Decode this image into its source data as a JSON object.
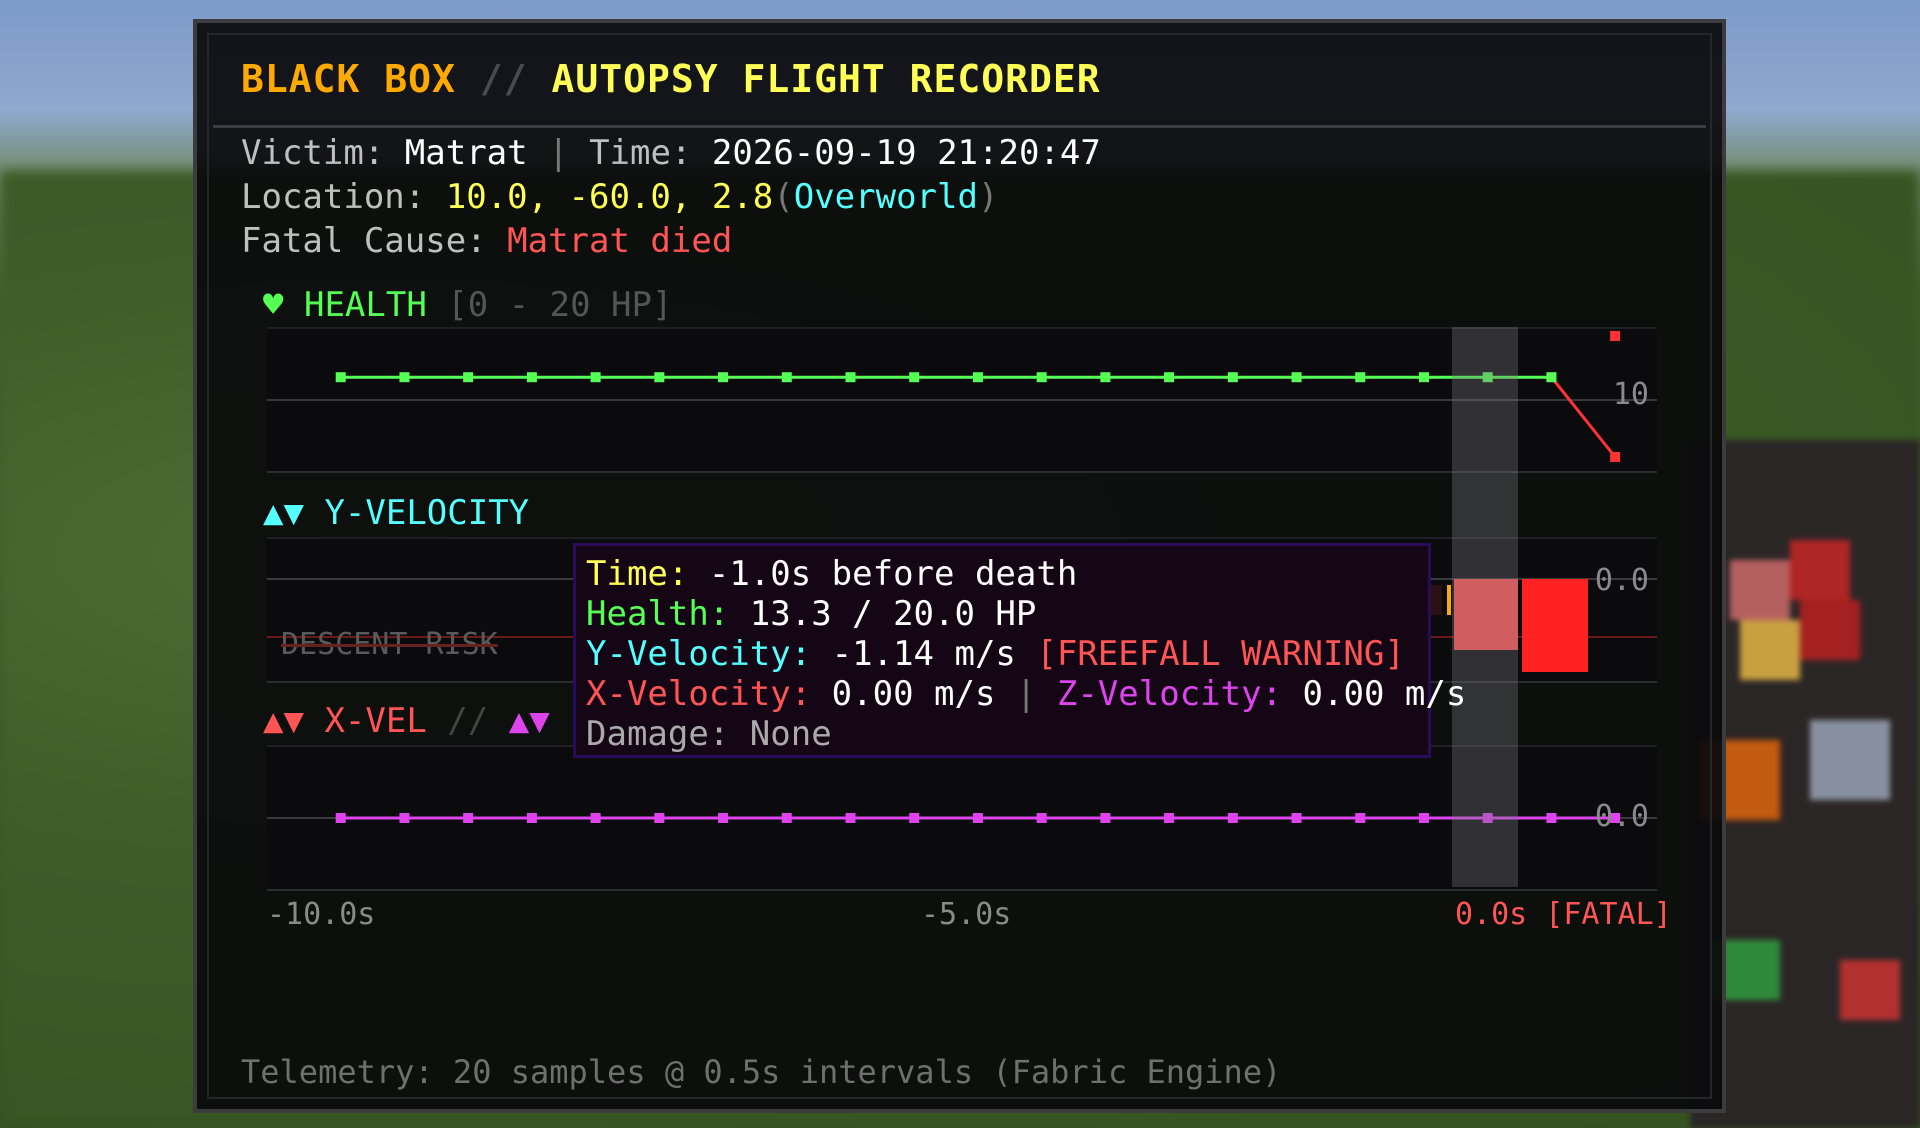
{
  "title": {
    "brand": "BLACK BOX",
    "sep": "//",
    "subtitle": "AUTOPSY FLIGHT RECORDER"
  },
  "info": {
    "victim_label": "Victim:",
    "victim": "Matrat",
    "bar": "|",
    "time_label": "Time:",
    "time": "2026-09-19 21:20:47",
    "location_label": "Location:",
    "location": "10.0, -60.0, 2.8",
    "dimension_open": "(",
    "dimension": "Overworld",
    "dimension_close": ")",
    "cause_label": "Fatal Cause:",
    "cause": "Matrat died"
  },
  "sections": {
    "health": {
      "icon": "heart-icon",
      "label": "HEALTH",
      "range": "[0 - 20 HP]",
      "tick_label": "10"
    },
    "yvel": {
      "icon": "up-down-arrows-icon",
      "label": "Y-VELOCITY",
      "zero_label": "0.0",
      "risk_label": "DESCENT RISK"
    },
    "xzvel": {
      "icon": "up-down-arrows-icon",
      "label_x": "X-VEL",
      "sep": "//",
      "zero_label": "0.0"
    }
  },
  "time_axis": {
    "left": "-10.0s",
    "mid": "-5.0s",
    "right": "0.0s [FATAL]"
  },
  "tooltip": {
    "time_label": "Time:",
    "time": "-1.0s before death",
    "health_label": "Health:",
    "health": "13.3 / 20.0 HP",
    "yvel_label": "Y-Velocity:",
    "yvel": "-1.14 m/s",
    "yvel_warning": "[FREEFALL WARNING]",
    "xvel_label": "X-Velocity:",
    "xvel": "0.00 m/s",
    "bar": "|",
    "zvel_label": "Z-Velocity:",
    "zvel": "0.00 m/s",
    "damage_label": "Damage:",
    "damage": "None"
  },
  "footer": "Telemetry: 20 samples @ 0.5s intervals (Fabric Engine)",
  "chart_data": {
    "type": "line",
    "x": [
      -10.0,
      -9.5,
      -9.0,
      -8.5,
      -8.0,
      -7.5,
      -7.0,
      -6.5,
      -6.0,
      -5.5,
      -5.0,
      -4.5,
      -4.0,
      -3.5,
      -3.0,
      -2.5,
      -2.0,
      -1.5,
      -1.0,
      -0.5,
      0.0
    ],
    "series": [
      {
        "name": "HEALTH",
        "color": "#55ff55",
        "fatal_color": "#ff3333",
        "values": [
          13.3,
          13.3,
          13.3,
          13.3,
          13.3,
          13.3,
          13.3,
          13.3,
          13.3,
          13.3,
          13.3,
          13.3,
          13.3,
          13.3,
          13.3,
          13.3,
          13.3,
          13.3,
          13.3,
          13.3,
          0
        ],
        "ylim": [
          0,
          20
        ]
      },
      {
        "name": "Y-VELOCITY",
        "color": "#ff5555",
        "values_tail": [
          -1.14,
          -1.5
        ],
        "ylim": [
          -1.5,
          0.5
        ]
      },
      {
        "name": "X-VEL",
        "color": "#ff5555",
        "values": [
          0,
          0,
          0,
          0,
          0,
          0,
          0,
          0,
          0,
          0,
          0,
          0,
          0,
          0,
          0,
          0,
          0,
          0,
          0,
          0,
          0
        ]
      },
      {
        "name": "Z-VEL",
        "color": "#dd44ee",
        "values": [
          0,
          0,
          0,
          0,
          0,
          0,
          0,
          0,
          0,
          0,
          0,
          0,
          0,
          0,
          0,
          0,
          0,
          0,
          0,
          0,
          0
        ]
      }
    ],
    "highlight_x": -1.0
  }
}
